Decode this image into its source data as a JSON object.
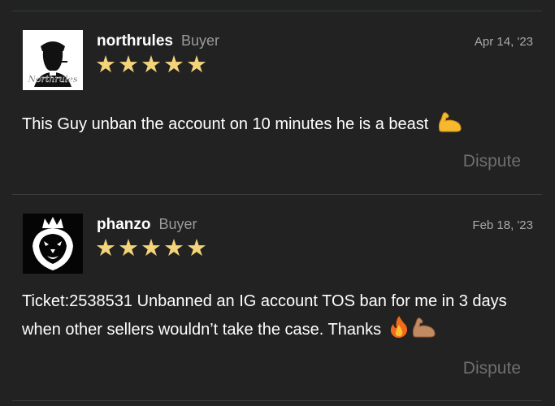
{
  "reviews": [
    {
      "username": "northrules",
      "role": "Buyer",
      "date": "Apr 14, '23",
      "stars": "★★★★★",
      "rating": 5,
      "avatar_text": "Northrules",
      "text": "This Guy unban the account on 10 minutes he is a beast",
      "emojis": [
        "flexed-biceps"
      ],
      "dispute_label": "Dispute"
    },
    {
      "username": "phanzo",
      "role": "Buyer",
      "date": "Feb 18, '23",
      "stars": "★★★★★",
      "rating": 5,
      "text": "Ticket:2538531 Unbanned an IG account TOS ban for me in 3 days when other sellers wouldn’t take the case. Thanks",
      "emojis": [
        "fire",
        "flexed-biceps-medium-skin"
      ],
      "dispute_label": "Dispute"
    }
  ],
  "colors": {
    "background": "#222222",
    "star": "#f3d47b",
    "role": "#9a9a9a",
    "dispute": "#6e6e6e"
  }
}
